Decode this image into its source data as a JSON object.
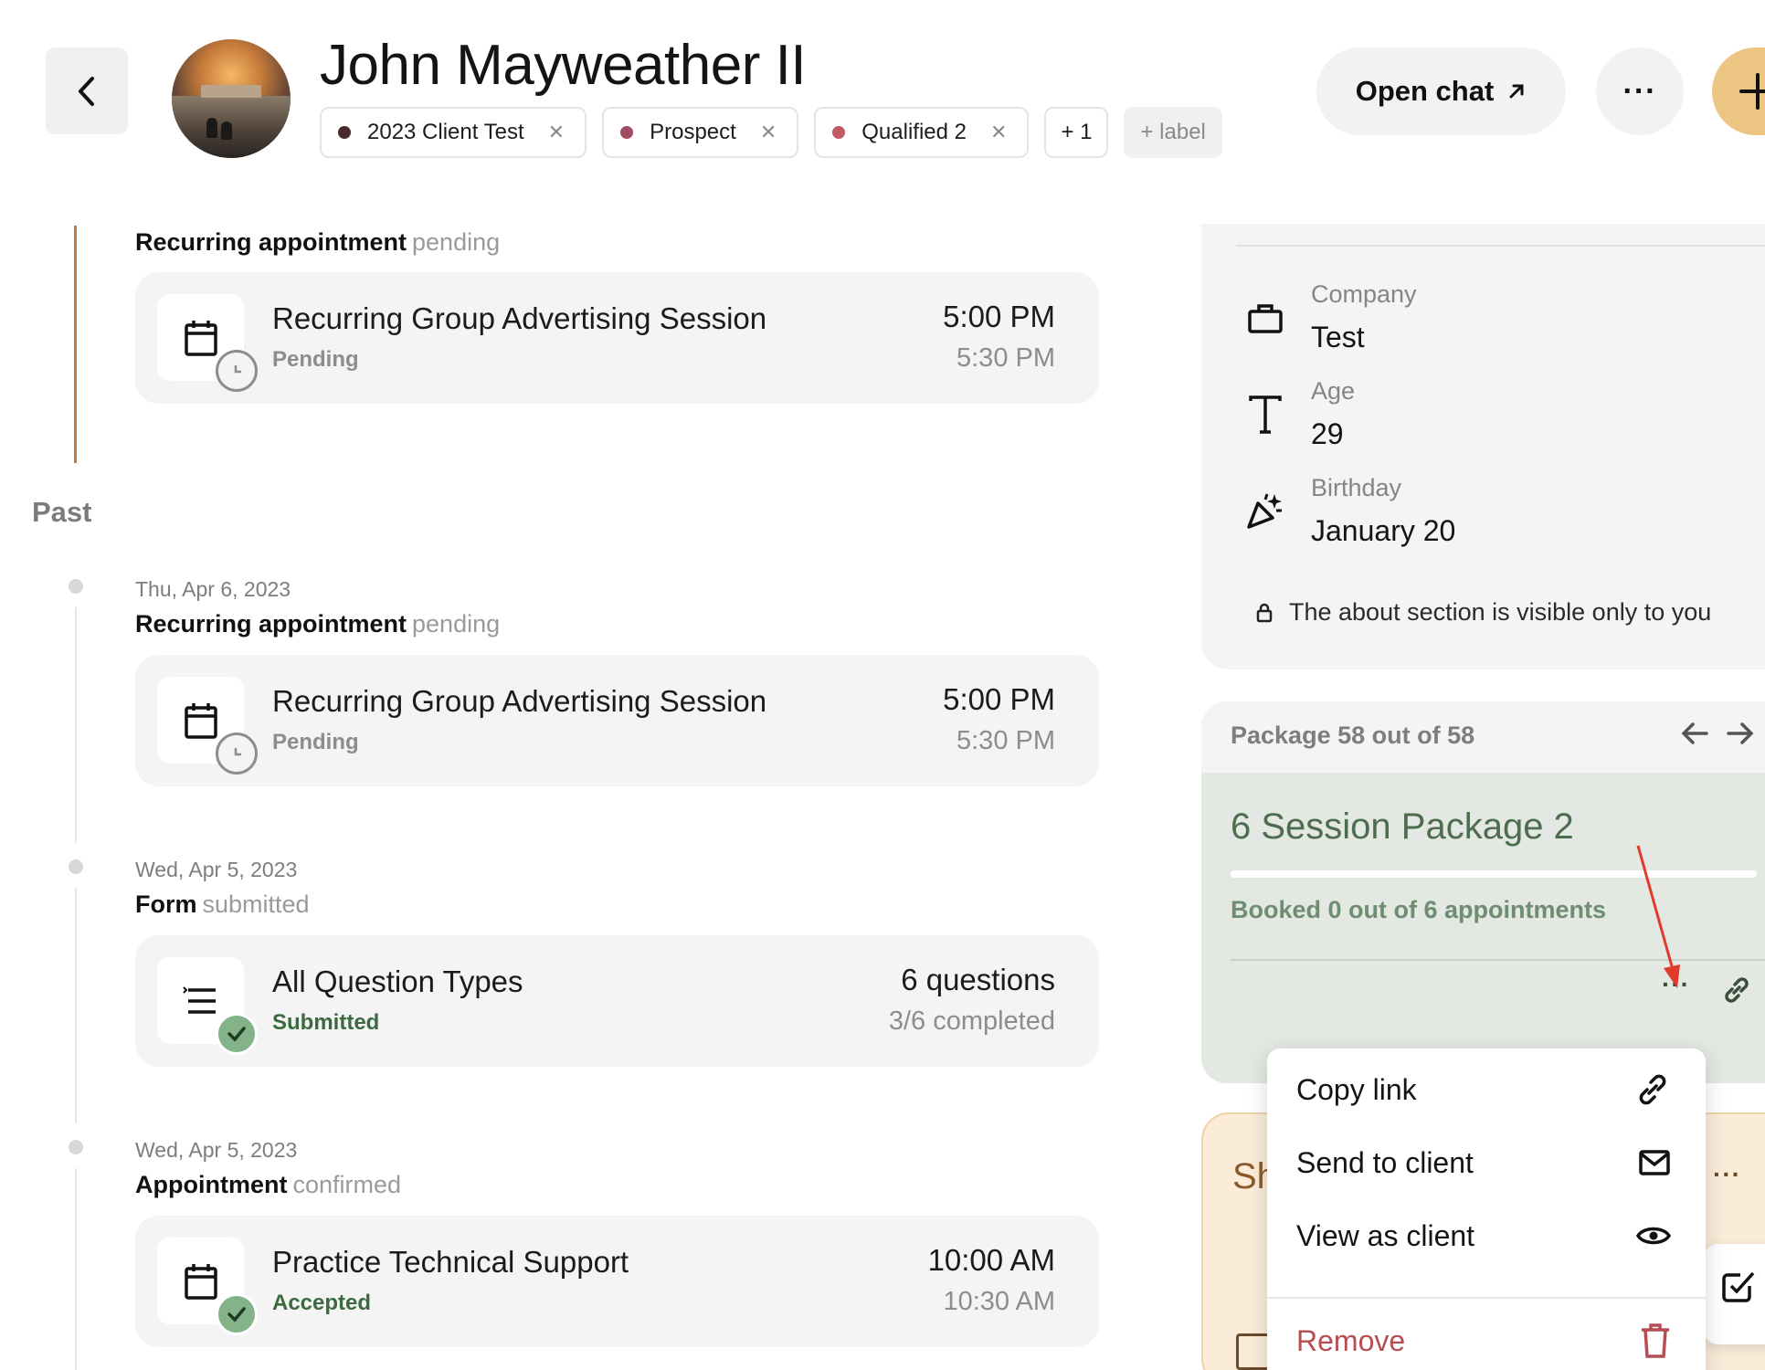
{
  "header": {
    "name": "John Mayweather II",
    "tags": [
      {
        "label": "2023 Client Test",
        "color": "#4a2a2e"
      },
      {
        "label": "Prospect",
        "color": "#a04f62"
      },
      {
        "label": "Qualified 2",
        "color": "#c05a63"
      }
    ],
    "more_tags": "+ 1",
    "add_label": "+ label",
    "open_chat": "Open chat",
    "more_menu": "···"
  },
  "timeline": {
    "past_label": "Past",
    "events": [
      {
        "date": "",
        "kind": "Recurring appointment",
        "state": "pending",
        "title": "Recurring Group Advertising Session",
        "status": "Pending",
        "right1": "5:00 PM",
        "right2": "5:30 PM"
      },
      {
        "date": "Thu, Apr 6, 2023",
        "kind": "Recurring appointment",
        "state": "pending",
        "title": "Recurring Group Advertising Session",
        "status": "Pending",
        "right1": "5:00 PM",
        "right2": "5:30 PM"
      },
      {
        "date": "Wed, Apr 5, 2023",
        "kind": "Form",
        "state": "submitted",
        "title": "All Question Types",
        "status": "Submitted",
        "right1": "6 questions",
        "right2": "3/6 completed"
      },
      {
        "date": "Wed, Apr 5, 2023",
        "kind": "Appointment",
        "state": "confirmed",
        "title": "Practice Technical Support",
        "status": "Accepted",
        "right1": "10:00 AM",
        "right2": "10:30 AM"
      }
    ]
  },
  "about": {
    "company_label": "Company",
    "company_value": "Test",
    "age_label": "Age",
    "age_value": "29",
    "birthday_label": "Birthday",
    "birthday_value": "January 20",
    "privacy_note": "The about section is visible only to you"
  },
  "package": {
    "counter": "Package 58 out of 58",
    "title": "6 Session Package 2",
    "booked": "Booked 0 out of 6 appointments",
    "progress_fraction": 0
  },
  "shared": {
    "title_partial": "Sh"
  },
  "menu": {
    "copy_link": "Copy link",
    "send_to_client": "Send to client",
    "view_as_client": "View as client",
    "remove": "Remove"
  }
}
